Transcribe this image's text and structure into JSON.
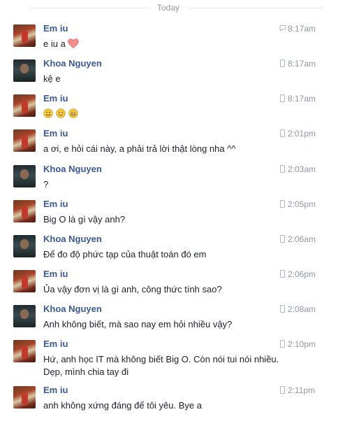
{
  "divider": {
    "label": "Today"
  },
  "messages": [
    {
      "sender": "Em iu",
      "time": "8:17am",
      "device": "chat-icon",
      "text": "e iu a"
    },
    {
      "sender": "Khoa Nguyen",
      "time": "8:17am",
      "device": "mobile-icon",
      "text": "kệ e"
    },
    {
      "sender": "Em iu",
      "time": "8:17am",
      "device": "mobile-icon",
      "text": ""
    },
    {
      "sender": "Em iu",
      "time": "2:01pm",
      "device": "mobile-icon",
      "text": "a ơi, e hỏi cái này, a phải trả lời thật lòng nha ^^"
    },
    {
      "sender": "Khoa Nguyen",
      "time": "2:03am",
      "device": "mobile-icon",
      "text": "?"
    },
    {
      "sender": "Em iu",
      "time": "2:05pm",
      "device": "mobile-icon",
      "text": "Big O là gì vậy anh?"
    },
    {
      "sender": "Khoa Nguyen",
      "time": "2:06am",
      "device": "mobile-icon",
      "text": "Để đo độ phức tạp của thuật toán đó em"
    },
    {
      "sender": "Em iu",
      "time": "2:06pm",
      "device": "mobile-icon",
      "text": "Ủa vậy đơn vị là gì anh, công thức tính sao?"
    },
    {
      "sender": "Khoa Nguyen",
      "time": "2:08am",
      "device": "mobile-icon",
      "text": "Anh không biết, mà sao nay em hỏi nhiều vậy?"
    },
    {
      "sender": "Em iu",
      "time": "2:10pm",
      "device": "mobile-icon",
      "text_line1": "Hứ, anh học IT mà không biết Big O. Còn nói tui nói nhiều.",
      "text_line2": "Dẹp, mình chia tay đi"
    },
    {
      "sender": "Em iu",
      "time": "2:11pm",
      "device": "mobile-icon",
      "text": "anh không xứng đáng để tôi yêu. Bye a"
    }
  ],
  "colors": {
    "name": "#3b5998",
    "meta": "#9197a3",
    "text": "#1d2129",
    "heart": "#f28b8b",
    "emoji": "#f5c842"
  }
}
